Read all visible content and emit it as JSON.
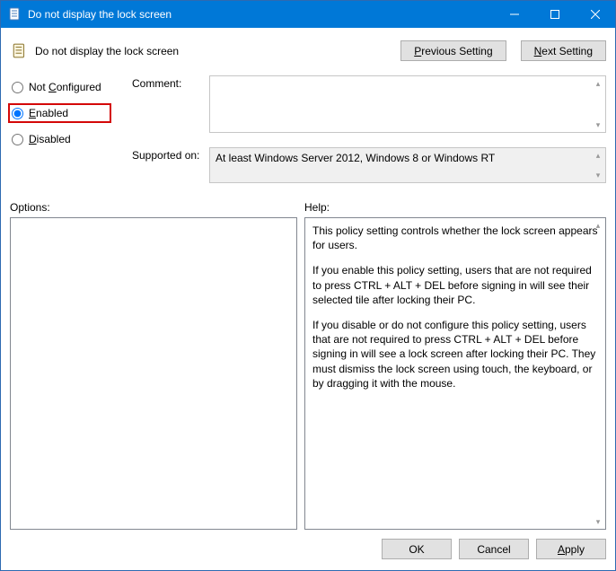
{
  "titlebar": {
    "title": "Do not display the lock screen"
  },
  "header": {
    "title": "Do not display the lock screen",
    "prev_label_pre": "P",
    "prev_label_rest": "revious Setting",
    "next_label_pre": "N",
    "next_label_rest": "ext Setting"
  },
  "radios": {
    "not_configured_pre": "Not ",
    "not_configured_u": "C",
    "not_configured_rest": "onfigured",
    "enabled_u": "E",
    "enabled_rest": "nabled",
    "disabled_u": "D",
    "disabled_rest": "isabled",
    "selected": "enabled"
  },
  "labels": {
    "comment": "Comment:",
    "supported": "Supported on:",
    "options": "Options:",
    "help": "Help:"
  },
  "supported_text": "At least Windows Server 2012, Windows 8 or Windows RT",
  "comment_text": "",
  "help": {
    "p1": "This policy setting controls whether the lock screen appears for users.",
    "p2": "If you enable this policy setting, users that are not required to press CTRL + ALT + DEL before signing in will see their selected tile after locking their PC.",
    "p3": "If you disable or do not configure this policy setting, users that are not required to press CTRL + ALT + DEL before signing in will see a lock screen after locking their PC. They must dismiss the lock screen using touch, the keyboard, or by dragging it with the mouse."
  },
  "footer": {
    "ok": "OK",
    "cancel": "Cancel",
    "apply_u": "A",
    "apply_rest": "pply"
  }
}
